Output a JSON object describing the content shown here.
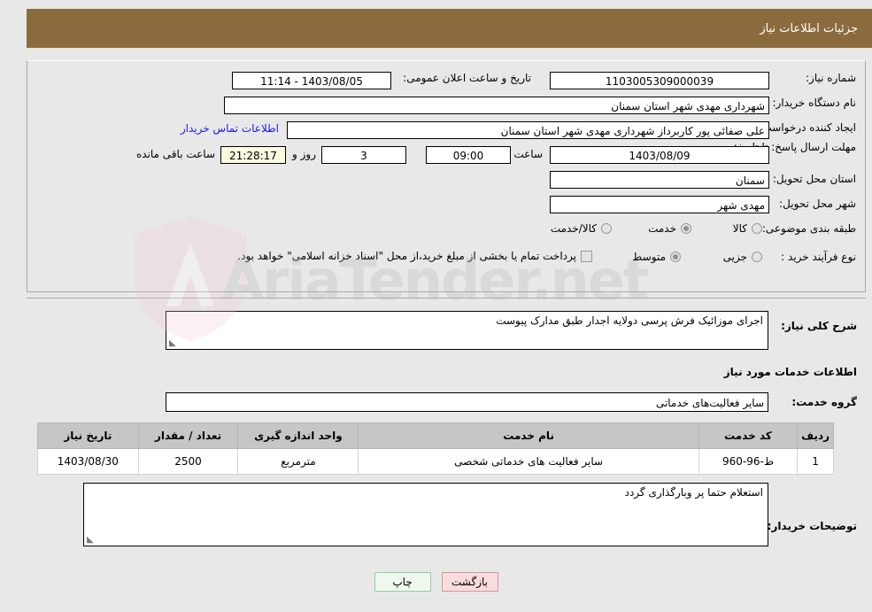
{
  "header": {
    "title": "جزئیات اطلاعات نیاز"
  },
  "form": {
    "need_number_label": "شماره نیاز:",
    "need_number_value": "1103005309000039",
    "announce_label": "تاریخ و ساعت اعلان عمومی:",
    "announce_value": "1403/08/05 - 11:14",
    "buyer_org_label": "نام دستگاه خریدار:",
    "buyer_org_value": "شهرداری مهدی شهر استان سمنان",
    "creator_label": "ایجاد کننده درخواست:",
    "creator_value": "علی صفائی پور کاربرداز شهرداری مهدی شهر استان سمنان",
    "contact_link": "اطلاعات تماس خریدار",
    "deadline_label": "مهلت ارسال پاسخ: تا تاریخ:",
    "deadline_date": "1403/08/09",
    "hour_label": "ساعت",
    "hour_value": "09:00",
    "days_value": "3",
    "days_label": "روز و",
    "countdown_value": "21:28:17",
    "remaining_label": "ساعت باقی مانده",
    "province_label": "استان محل تحویل:",
    "province_value": "سمنان",
    "city_label": "شهر محل تحویل:",
    "city_value": "مهدی شهر",
    "category_label": "طبقه بندی موضوعی:",
    "category_options": [
      {
        "label": "کالا",
        "selected": false
      },
      {
        "label": "خدمت",
        "selected": true
      },
      {
        "label": "کالا/خدمت",
        "selected": false
      }
    ],
    "process_label": "نوع فرآیند خرید :",
    "process_options": [
      {
        "label": "جزیی",
        "selected": false
      },
      {
        "label": "متوسط",
        "selected": true
      }
    ],
    "treasury_checkbox_checked": false,
    "treasury_text": "پرداخت تمام یا بخشی از مبلغ خرید،از محل \"اسناد خزانه اسلامی\" خواهد بود."
  },
  "description": {
    "label": "شرح کلی نیاز:",
    "value": "اجرای موزائیک فرش پرسی دولایه اجدار طبق مدارک پیوست"
  },
  "services_section": {
    "heading": "اطلاعات خدمات مورد نیاز",
    "group_label": "گروه خدمت:",
    "group_value": "سایر فعالیت‌های خدماتی"
  },
  "table": {
    "columns": [
      "ردیف",
      "کد خدمت",
      "نام خدمت",
      "واحد اندازه گیری",
      "تعداد / مقدار",
      "تاریخ نیاز"
    ],
    "rows": [
      {
        "radif": "1",
        "code": "ط-96-960",
        "name": "سایر فعالیت های خدماتی شخصی",
        "unit": "مترمربع",
        "qty": "2500",
        "date": "1403/08/30"
      }
    ]
  },
  "buyer_notes": {
    "label": "توضیحات خریدار:",
    "value": "استعلام حتما پر وبارگذاری گردد"
  },
  "buttons": {
    "back": "بازگشت",
    "print": "چاپ"
  },
  "watermark": {
    "text": "AriaTender.net"
  },
  "colors": {
    "header_bg": "#8b6b3d",
    "link": "#1a1ae6",
    "back_btn": "#fbdcdc",
    "print_btn": "#eef8ee",
    "countdown_bg": "#fbfbe0",
    "table_header_bg": "#c6c6c6",
    "page_bg": "#e8e8e8"
  }
}
